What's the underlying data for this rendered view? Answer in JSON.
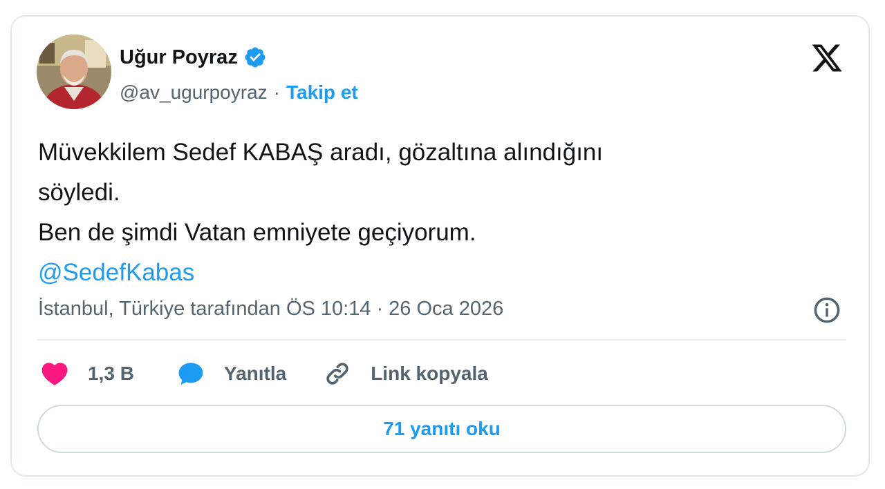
{
  "author": {
    "name": "Uğur Poyraz",
    "handle": "@av_ugurpoyraz",
    "separator": "·",
    "follow_label": "Takip et",
    "verified": true
  },
  "tweet": {
    "lines": [
      "Müvekkilem Sedef KABAŞ aradı, gözaltına alındığını",
      "söyledi.",
      "Ben de şimdi Vatan emniyete geçiyorum."
    ],
    "mention": "@SedefKabas"
  },
  "meta": {
    "location": "İstanbul, Türkiye tarafından",
    "time": "ÖS 10:14",
    "separator": "·",
    "date": "26 Oca 2026"
  },
  "actions": {
    "likes": "1,3 B",
    "reply_label": "Yanıtla",
    "copy_link_label": "Link kopyala"
  },
  "replies_button": "71 yanıtı oku",
  "icons": {
    "verified": "verified-badge-icon",
    "platform": "x-logo-icon",
    "info": "info-icon",
    "like": "heart-icon",
    "reply": "speech-bubble-icon",
    "copy_link": "link-icon"
  },
  "colors": {
    "accent": "#1d9bf0",
    "like": "#f91880",
    "muted_text": "#536471",
    "text": "#0f1419",
    "border": "#e1e8ed"
  }
}
